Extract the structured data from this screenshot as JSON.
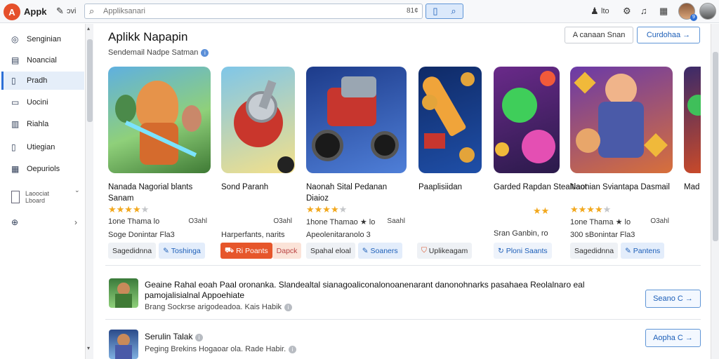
{
  "topbar": {
    "app_name": "Appk",
    "pencil_text": "ᴐvi",
    "search_placeholder": "Appliksanari",
    "search_kbd": "81¢",
    "right_text": "lto",
    "badge_count": "9"
  },
  "sidebar": {
    "items": [
      {
        "label": "Senginian",
        "icon": "compass-icon"
      },
      {
        "label": "Noancial",
        "icon": "grid-icon"
      },
      {
        "label": "Pradh",
        "icon": "doc-icon"
      },
      {
        "label": "Uocini",
        "icon": "monitor-icon"
      },
      {
        "label": "Riahla",
        "icon": "book-icon"
      },
      {
        "label": "Utiegian",
        "icon": "tablet-icon"
      },
      {
        "label": "Oepuriols",
        "icon": "calendar-icon"
      }
    ],
    "group_line1": "Laoociat",
    "group_line2": "Lboard"
  },
  "header": {
    "title": "Aplikk Napapin",
    "subtitle": "Sendemail Nadpe Satman",
    "btn_secondary": "A canaan Snan",
    "btn_primary": "Curdohaa →"
  },
  "cards": [
    {
      "name": "Nanada Nagorial blants Sanam",
      "rating": 4.5,
      "meta1": "1one Thama lo",
      "meta1_right": "O3ahl",
      "meta2": "Soge Donintar Fla3",
      "act1": "Sagedidnna",
      "act2": "Toshinga",
      "act2_icon": "pencil-icon"
    },
    {
      "name": "Sond Paranh",
      "rating": 0,
      "meta1": "",
      "meta1_right": "O3ahl",
      "meta2": "Harperfants, narits",
      "act1": "Ri Poants",
      "act2": "Dapck",
      "act1_icon": "cart-icon"
    },
    {
      "name": "Naonah Sital Pedanan Diaioz",
      "rating": 4.5,
      "meta1": "1hone Thamao ★ lo",
      "meta1_right": "Saahl",
      "meta2": "Apeolenitaranolo 3",
      "act1": "Spahal eloal",
      "act2": "Soaners",
      "act2_icon": "pencil-icon"
    },
    {
      "name": "Paaplisiidan",
      "rating": 0,
      "meta1": "",
      "meta1_right": "",
      "meta2": "",
      "act1": "Uplikeagam",
      "act2": "",
      "act1_icon": "shield-icon"
    },
    {
      "name": "Garded Rapdan Stealtiaot",
      "rating": 2,
      "meta1": "Sran Ganbin, ro",
      "meta1_right": "",
      "meta2": "",
      "act1": "Ploni Saants",
      "act2": "",
      "act1_icon": "refresh-icon"
    },
    {
      "name": "Naonian Sviantapa Dasmail",
      "rating": 4.5,
      "meta1": "1one Thama ★ lo",
      "meta1_right": "O3ahl",
      "meta2": "300 sBonintar Fla3",
      "act1": "Sagedidnna",
      "act2": "Pantens",
      "act2_icon": "pencil-icon"
    },
    {
      "name": "Mad",
      "rating": 0,
      "meta1": "",
      "meta1_right": "",
      "meta2": "",
      "act1": "",
      "act2": ""
    }
  ],
  "list": [
    {
      "title": "Geaine Rahal eoah Paal oronanka. Slandealtal sianagoaliconalonoanenarant danonohnarks pasahaea Reolalnaro eal pamojalisialnal Appoehiate",
      "sub": "Brang Sockrse arigodeadoa. Kais Habik",
      "button": "Seano C →"
    },
    {
      "title": "Serulin Talak",
      "sub": "Peging Brekins Hogaoar ola. Rade Habir.",
      "button": "Aopha C →"
    }
  ],
  "colors": {
    "accent": "#2d6fd6",
    "brand": "#e5502b",
    "star": "#f2a81d"
  }
}
